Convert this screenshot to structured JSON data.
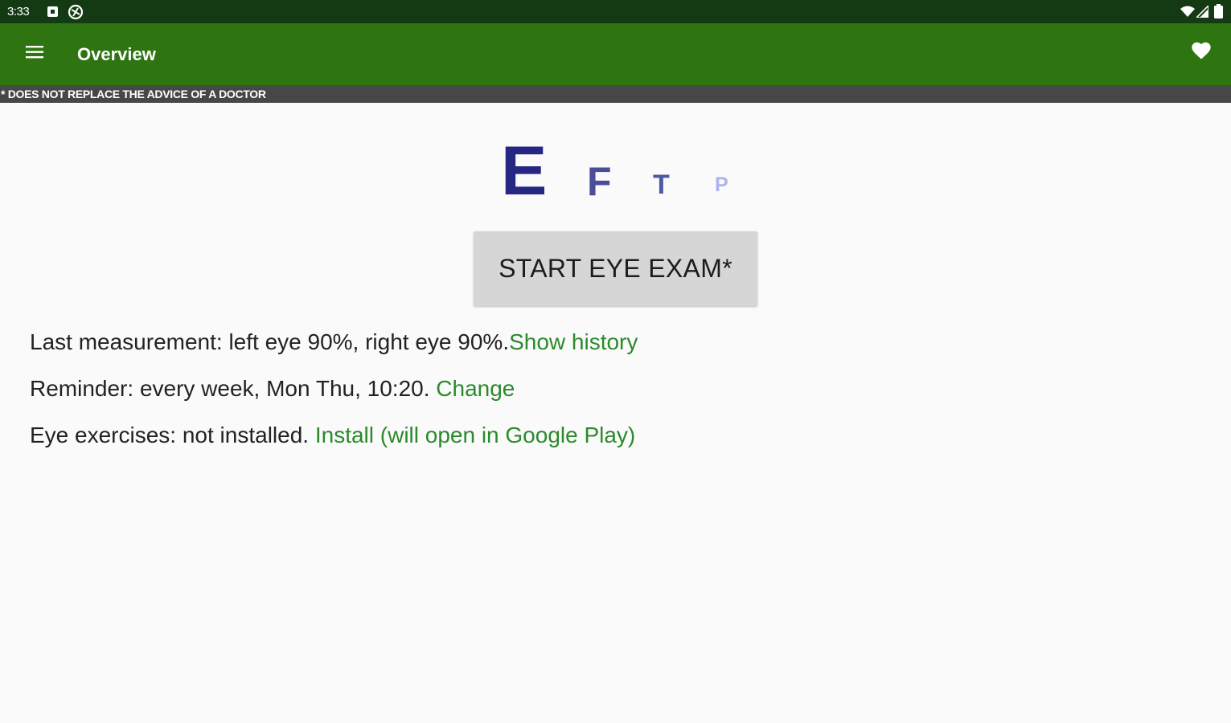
{
  "status_bar": {
    "time": "3:33",
    "icons": [
      "notification-icon",
      "sync-icon",
      "wifi-icon",
      "signal-icon",
      "battery-icon"
    ]
  },
  "app_bar": {
    "title": "Overview",
    "menu_icon": "hamburger-menu-icon",
    "favorite_icon": "heart-icon",
    "color": "#2e7512"
  },
  "disclaimer": {
    "text": "* DOES NOT REPLACE THE ADVICE OF A DOCTOR"
  },
  "eye_chart": {
    "letters": [
      {
        "char": "E",
        "color": "#252783"
      },
      {
        "char": "F",
        "color": "#4a4e99"
      },
      {
        "char": "T",
        "color": "#4d58a6"
      },
      {
        "char": "P",
        "color": "#aab4e8"
      }
    ]
  },
  "exam_button": {
    "label": "START EYE EXAM*"
  },
  "info": {
    "last_measurement": {
      "text": "Last measurement: left eye 90%, right eye 90%.",
      "link": "Show history"
    },
    "reminder": {
      "text": "Reminder: every week, Mon Thu, 10:20. ",
      "link": "Change"
    },
    "exercises": {
      "text": "Eye exercises: not installed. ",
      "link": "Install (will open in Google Play)"
    }
  },
  "colors": {
    "status_bar": "#143a14",
    "disclaimer_bar": "#474747",
    "link": "#2b8a2b",
    "background": "#fafafa"
  }
}
